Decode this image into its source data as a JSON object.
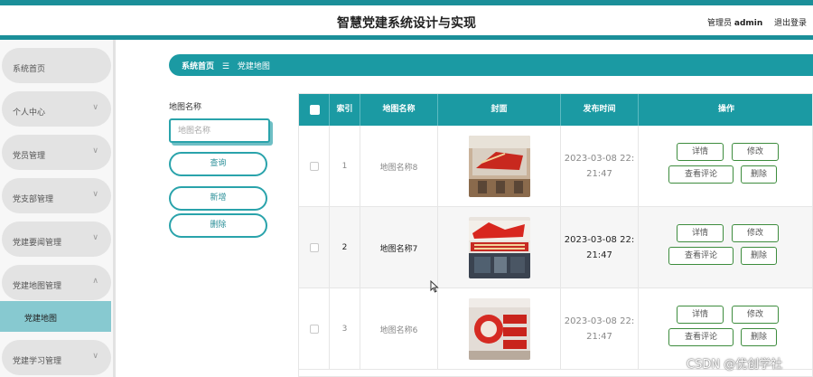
{
  "header": {
    "title": "智慧党建系统设计与实现",
    "user_role": "管理员",
    "username": "admin",
    "logout_label": "退出登录"
  },
  "sidebar": {
    "items": [
      {
        "label": "系统首页",
        "chevron": ""
      },
      {
        "label": "个人中心",
        "chevron": "∨"
      },
      {
        "label": "党员管理",
        "chevron": "∨"
      },
      {
        "label": "党支部管理",
        "chevron": "∨"
      },
      {
        "label": "党建要闻管理",
        "chevron": "∨"
      },
      {
        "label": "党建地图管理",
        "chevron": "∧"
      },
      {
        "label": "党建学习管理",
        "chevron": "∨"
      }
    ],
    "active_sub": "党建地图"
  },
  "breadcrumb": {
    "home": "系统首页",
    "separator": "☰",
    "current": "党建地图"
  },
  "search": {
    "label": "地图名称",
    "placeholder": "地图名称",
    "query_label": "查询",
    "add_label": "新增",
    "delete_label": "删除"
  },
  "table": {
    "columns": [
      "索引",
      "地图名称",
      "封面",
      "发布时间",
      "操作"
    ],
    "rows": [
      {
        "index": "1",
        "name": "地图名称8",
        "date": "2023-03-08 22:",
        "time": "21:47"
      },
      {
        "index": "2",
        "name": "地图名称7",
        "date": "2023-03-08 22:",
        "time": "21:47"
      },
      {
        "index": "3",
        "name": "地图名称6",
        "date": "2023-03-08 22:",
        "time": "21:47"
      }
    ],
    "actions": {
      "detail": "详情",
      "edit": "修改",
      "comments": "查看评论",
      "delete": "删除"
    }
  },
  "watermark": "CSDN @优创学社",
  "colors": {
    "accent": "#1b9aa3",
    "active_sub_bg": "#87c9d0",
    "action_border": "#3d8c3d"
  }
}
